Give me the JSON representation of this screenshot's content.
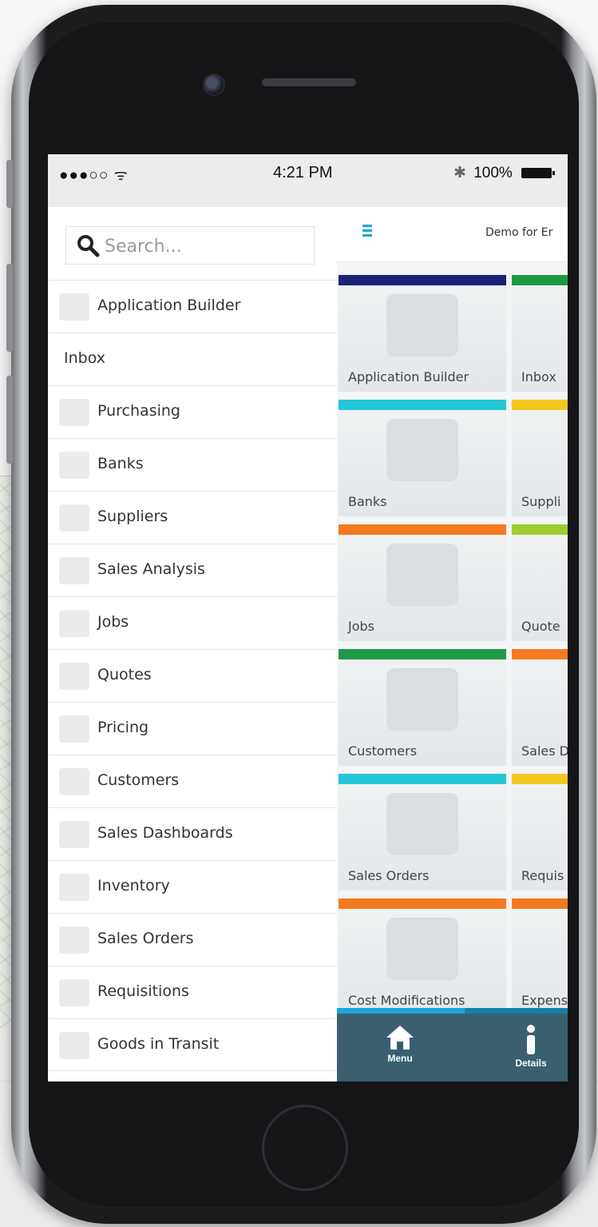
{
  "status_bar": {
    "signal": "●●●○○",
    "wifi": "ᯤ",
    "time": "4:21 PM",
    "bluetooth": "✱",
    "battery": "100%"
  },
  "search": {
    "placeholder": "Search..."
  },
  "menu": {
    "items": [
      {
        "label": "Application Builder",
        "icon": "person-icon"
      },
      {
        "label": "Inbox",
        "icon": ""
      },
      {
        "label": "Purchasing",
        "icon": "store-icon"
      },
      {
        "label": "Banks",
        "icon": "bank-icon"
      },
      {
        "label": "Suppliers",
        "icon": "boxes-icon"
      },
      {
        "label": "Sales Analysis",
        "icon": "trend-icon"
      },
      {
        "label": "Jobs",
        "icon": "calendar-icon"
      },
      {
        "label": "Quotes",
        "icon": "card-icon"
      },
      {
        "label": "Pricing",
        "icon": "tag-icon"
      },
      {
        "label": "Customers",
        "icon": "people-icon"
      },
      {
        "label": "Sales Dashboards",
        "icon": "dashboard-icon"
      },
      {
        "label": "Inventory",
        "icon": "box-icon"
      },
      {
        "label": "Sales Orders",
        "icon": "bag-icon"
      },
      {
        "label": "Requisitions",
        "icon": "form-icon"
      },
      {
        "label": "Goods in Transit",
        "icon": "truck-icon"
      }
    ]
  },
  "content": {
    "header_title": "Demo for Er",
    "tiles": [
      {
        "label": "Application Builder",
        "color": "#1b2275"
      },
      {
        "label": "Inbox",
        "color": "#1e9a46"
      },
      {
        "label": "Banks",
        "color": "#23c8d8"
      },
      {
        "label": "Suppli",
        "color": "#f2c81f"
      },
      {
        "label": "Jobs",
        "color": "#f47a20"
      },
      {
        "label": "Quote",
        "color": "#9ccc2e"
      },
      {
        "label": "Customers",
        "color": "#1e9a46"
      },
      {
        "label": "Sales D",
        "color": "#f47a20"
      },
      {
        "label": "Sales Orders",
        "color": "#23c8d8"
      },
      {
        "label": "Requis",
        "color": "#f2c81f"
      },
      {
        "label": "Cost Modifications",
        "color": "#f47a20"
      },
      {
        "label": "Expens",
        "color": "#f47a20"
      }
    ]
  },
  "bottom_tabs": {
    "menu_label": "Menu",
    "details_label": "Details"
  },
  "colors": {
    "accent": "#1aa7dc",
    "bottom_bar": "#3a6070"
  }
}
